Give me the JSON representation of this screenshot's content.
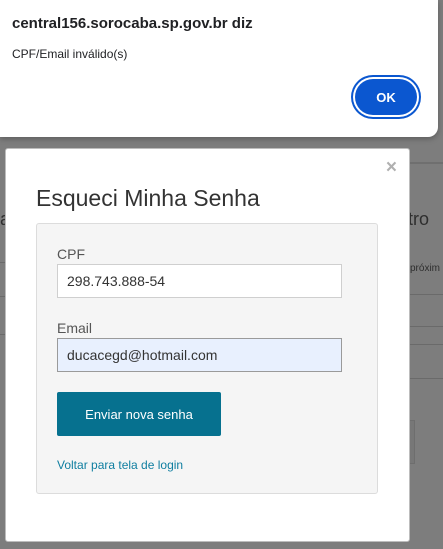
{
  "alert": {
    "title": "central156.sorocaba.sp.gov.br diz",
    "message": "CPF/Email inválido(s)",
    "ok_label": "OK"
  },
  "modal": {
    "close_glyph": "×",
    "title": "Esqueci Minha Senha",
    "cpf_label": "CPF",
    "cpf_value": "298.743.888-54",
    "email_label": "Email",
    "email_value": "ducacegd@hotmail.com",
    "send_label": "Enviar nova senha",
    "back_link": "Voltar para tela de login"
  },
  "background": {
    "left_fragment": "a",
    "right_fragment": "tro",
    "right_small": "próxim"
  },
  "colors": {
    "alert_ok": "#0b57d0",
    "primary_button": "#06718f",
    "link": "#0f7ea0"
  }
}
